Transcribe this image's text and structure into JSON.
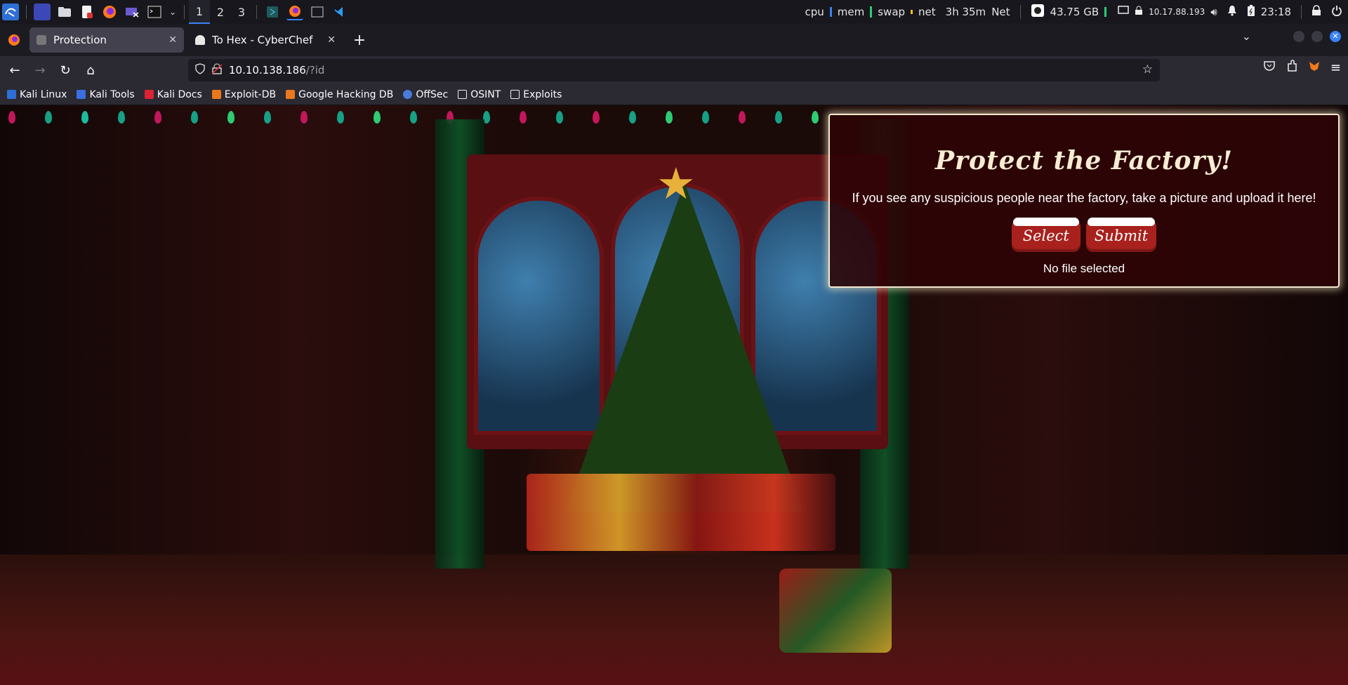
{
  "taskbar": {
    "workspaces": [
      "1",
      "2",
      "3"
    ],
    "meters": {
      "cpu": "cpu",
      "mem": "mem",
      "swap": "swap",
      "net": "net"
    },
    "uptime": "3h 35m",
    "net_label": "Net",
    "disk": "43.75 GB",
    "ip": "10.17.88.193",
    "clock": "23:18"
  },
  "browser": {
    "tabs": [
      {
        "title": "Protection",
        "active": true
      },
      {
        "title": "To Hex - CyberChef",
        "active": false
      }
    ],
    "url": {
      "host": "10.10.138.186",
      "path": "/?id"
    },
    "bookmarks": [
      "Kali Linux",
      "Kali Tools",
      "Kali Docs",
      "Exploit-DB",
      "Google Hacking DB",
      "OffSec",
      "OSINT",
      "Exploits"
    ]
  },
  "page": {
    "title": "Protect the Factory!",
    "description": "If you see any suspicious people near the factory, take a picture and upload it here!",
    "select_label": "Select",
    "submit_label": "Submit",
    "file_status": "No file selected"
  },
  "colors": {
    "accent": "#3b82f6",
    "card_border": "#f5e9cf",
    "button_red": "#a8211c"
  }
}
